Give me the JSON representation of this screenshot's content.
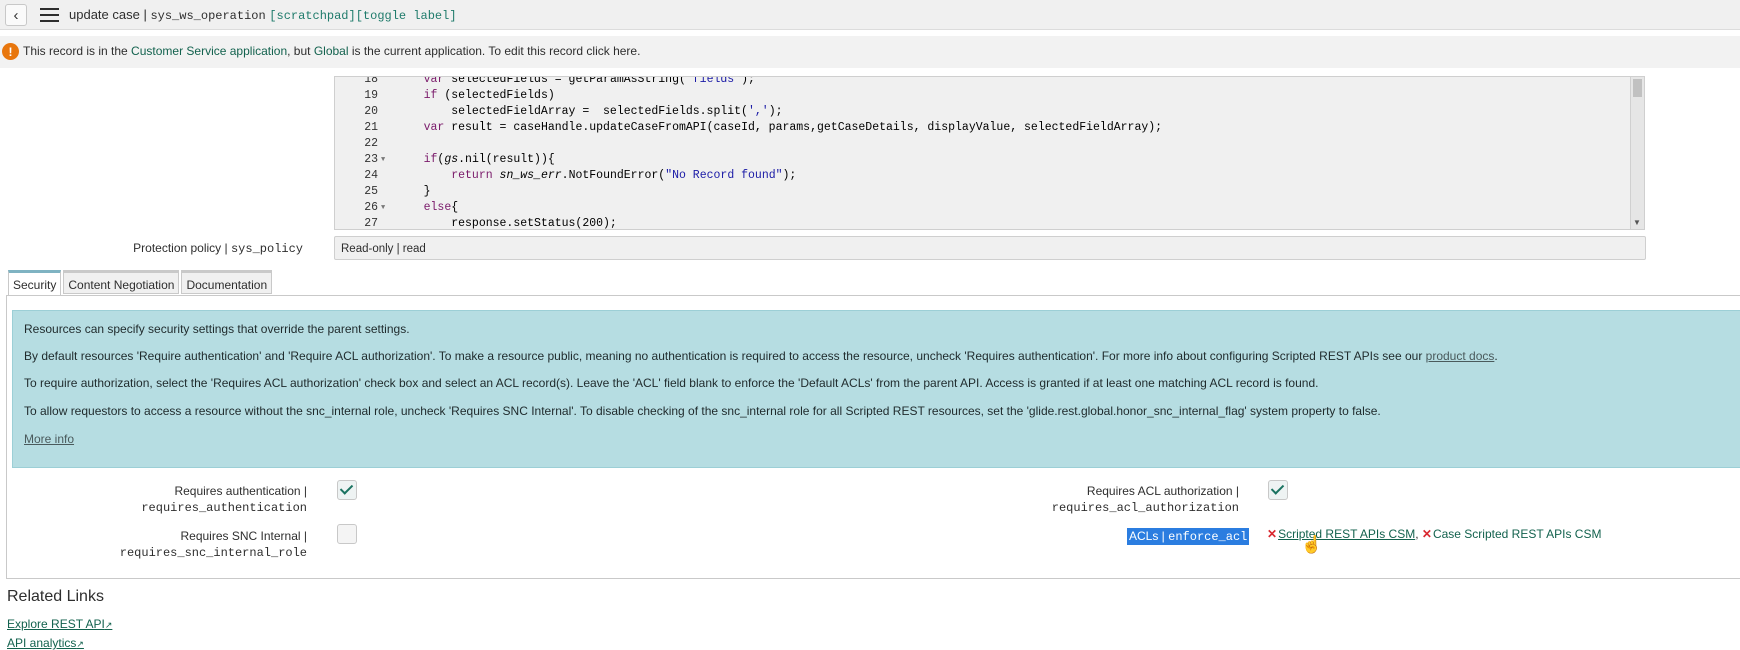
{
  "header": {
    "title": "update case",
    "separator": " | ",
    "table": "sys_ws_operation",
    "tags": "[scratchpad][toggle label]"
  },
  "notice": {
    "prefix": "This record is in the ",
    "app_name": "Customer Service",
    "app_word": " application",
    "middle": ", but ",
    "global": "Global",
    "suffix": " is the current application. To edit this record ",
    "click_here": "click here",
    "end": "."
  },
  "code": {
    "lines": [
      {
        "n": "18",
        "fold": "",
        "html": "    <span class=\"kw\">var</span> selectedFields = getParamAsString(<span class=\"str\">'fields'</span>);"
      },
      {
        "n": "19",
        "fold": "",
        "html": "    <span class=\"kw\">if</span> (selectedFields)"
      },
      {
        "n": "20",
        "fold": "",
        "html": "        selectedFieldArray =  selectedFields.split(<span class=\"str\">','</span>);"
      },
      {
        "n": "21",
        "fold": "",
        "html": "    <span class=\"kw\">var</span> result = caseHandle.updateCaseFromAPI(caseId, params,getCaseDetails, displayValue, selectedFieldArray);"
      },
      {
        "n": "22",
        "fold": "",
        "html": ""
      },
      {
        "n": "23",
        "fold": "▼",
        "html": "    <span class=\"kw\">if</span>(<span class=\"it\">gs</span>.nil(result)){"
      },
      {
        "n": "24",
        "fold": "",
        "html": "        <span class=\"kw\">return</span> <span class=\"it\">sn_ws_err</span>.NotFoundError(<span class=\"str\">\"No Record found\"</span>);"
      },
      {
        "n": "25",
        "fold": "",
        "html": "    }"
      },
      {
        "n": "26",
        "fold": "▼",
        "html": "    <span class=\"kw\">else</span>{"
      },
      {
        "n": "27",
        "fold": "",
        "html": "        response.setStatus(200);"
      }
    ]
  },
  "protection_policy": {
    "label": "Protection policy",
    "sep": " | ",
    "field": "sys_policy",
    "value": "Read-only | read"
  },
  "tabs": [
    {
      "label": "Security"
    },
    {
      "label": "Content Negotiation"
    },
    {
      "label": "Documentation"
    }
  ],
  "info": {
    "p1": "Resources can specify security settings that override the parent settings.",
    "p2": "By default resources 'Require authentication' and 'Require ACL authorization'. To make a resource public, meaning no authentication is required to access the resource, uncheck 'Requires authentication'. For more info about configuring Scripted REST APIs see our ",
    "p2_link": "product docs",
    "p2_end": ".",
    "p3": "To require authorization, select the 'Requires ACL authorization' check box and select an ACL record(s). Leave the 'ACL' field blank to enforce the 'Default ACLs' from the parent API. Access is granted if at least one matching ACL record is found.",
    "p4": "To allow requestors to access a resource without the snc_internal role, uncheck 'Requires SNC Internal'. To disable checking of the snc_internal role for all Scripted REST resources, set the 'glide.rest.global.honor_snc_internal_flag' system property to false.",
    "more_info": "More info"
  },
  "fields": {
    "req_auth": {
      "label": "Requires authentication |",
      "name": "requires_authentication",
      "checked": true
    },
    "req_acl": {
      "label": "Requires ACL authorization |",
      "name": "requires_acl_authorization",
      "checked": true
    },
    "req_snc": {
      "label": "Requires SNC Internal |",
      "name": "requires_snc_internal_role",
      "checked": false
    },
    "acls": {
      "label": "ACLs",
      "sep": " | ",
      "name": "enforce_acl",
      "items": [
        "Scripted REST APIs CSM",
        "Case Scripted REST APIs CSM"
      ],
      "item_sep": ", "
    }
  },
  "related": {
    "title": "Related Links",
    "links": [
      "Explore REST API",
      "API analytics"
    ]
  },
  "colors": {
    "accent": "#13624e",
    "warning": "#e8760d",
    "info_bg": "#b6dde2",
    "highlight": "#2b7de0"
  }
}
